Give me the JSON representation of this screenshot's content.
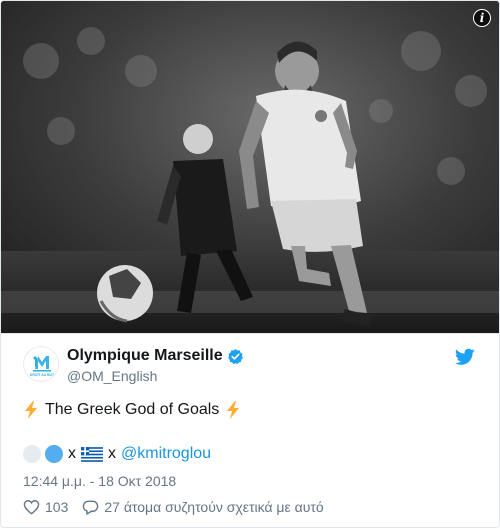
{
  "media": {
    "description_icon": "info-icon",
    "info_label": "i"
  },
  "author": {
    "display_name": "Olympique Marseille",
    "handle": "@OM_English",
    "verified": true,
    "avatar_icon": "om-crest-icon",
    "avatar_text": "DROIT AU BUT"
  },
  "tweet": {
    "text": "The Greek God of Goals",
    "mention_sep1": "x",
    "mention_sep2": "x",
    "mention": "@kmitroglou",
    "timestamp": "12:44 μ.μ. - 18 Οκτ 2018"
  },
  "actions": {
    "likes": "103",
    "conversation": "27 άτομα συζητούν σχετικά με αυτό"
  },
  "colors": {
    "link": "#1b95e0",
    "secondary_text": "#657786",
    "twitter_blue": "#1da1f2",
    "bolt_yellow": "#ffac33"
  }
}
